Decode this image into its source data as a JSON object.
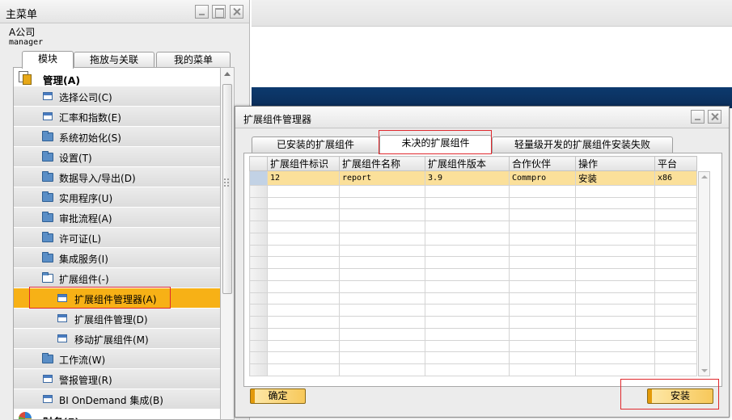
{
  "main_menu": {
    "title": "主菜单",
    "company": "A公司",
    "user": "manager",
    "tabs": [
      "模块",
      "拖放与关联",
      "我的菜单"
    ],
    "items": [
      {
        "label": "管理(A)",
        "level": 0,
        "icon": "module-icon"
      },
      {
        "label": "选择公司(C)",
        "level": 1,
        "icon": "form-icon"
      },
      {
        "label": "汇率和指数(E)",
        "level": 1,
        "icon": "form-icon"
      },
      {
        "label": "系统初始化(S)",
        "level": 1,
        "icon": "folder-icon"
      },
      {
        "label": "设置(T)",
        "level": 1,
        "icon": "folder-icon"
      },
      {
        "label": "数据导入/导出(D)",
        "level": 1,
        "icon": "folder-icon"
      },
      {
        "label": "实用程序(U)",
        "level": 1,
        "icon": "folder-icon"
      },
      {
        "label": "审批流程(A)",
        "level": 1,
        "icon": "folder-icon"
      },
      {
        "label": "许可证(L)",
        "level": 1,
        "icon": "folder-icon"
      },
      {
        "label": "集成服务(I)",
        "level": 1,
        "icon": "folder-icon"
      },
      {
        "label": "扩展组件(-)",
        "level": 1,
        "icon": "folder-open-icon"
      },
      {
        "label": "扩展组件管理器(A)",
        "level": 2,
        "icon": "form-icon",
        "selected": true
      },
      {
        "label": "扩展组件管理(D)",
        "level": 2,
        "icon": "form-icon"
      },
      {
        "label": "移动扩展组件(M)",
        "level": 2,
        "icon": "form-icon"
      },
      {
        "label": "工作流(W)",
        "level": 1,
        "icon": "folder-icon"
      },
      {
        "label": "警报管理(R)",
        "level": 1,
        "icon": "form-icon"
      },
      {
        "label": "BI OnDemand 集成(B)",
        "level": 1,
        "icon": "form-icon"
      },
      {
        "label": "财务(F)",
        "level": 0,
        "icon": "pie-icon"
      }
    ]
  },
  "dialog": {
    "title": "扩展组件管理器",
    "tabs": [
      "已安装的扩展组件",
      "未决的扩展组件",
      "轻量级开发的扩展组件安装失败"
    ],
    "active_tab": 1,
    "columns": [
      "扩展组件标识",
      "扩展组件名称",
      "扩展组件版本",
      "合作伙伴",
      "操作",
      "平台"
    ],
    "rows": [
      [
        "12",
        "report",
        "3.9",
        "Commpro",
        "安装",
        "x86"
      ]
    ],
    "ok_button": "确定",
    "install_button": "安装"
  },
  "colors": {
    "selection": "#f7b116",
    "row_highlight": "#fbe09a",
    "annotation_box": "#e0282d",
    "button_gold": "#f7c85a"
  }
}
